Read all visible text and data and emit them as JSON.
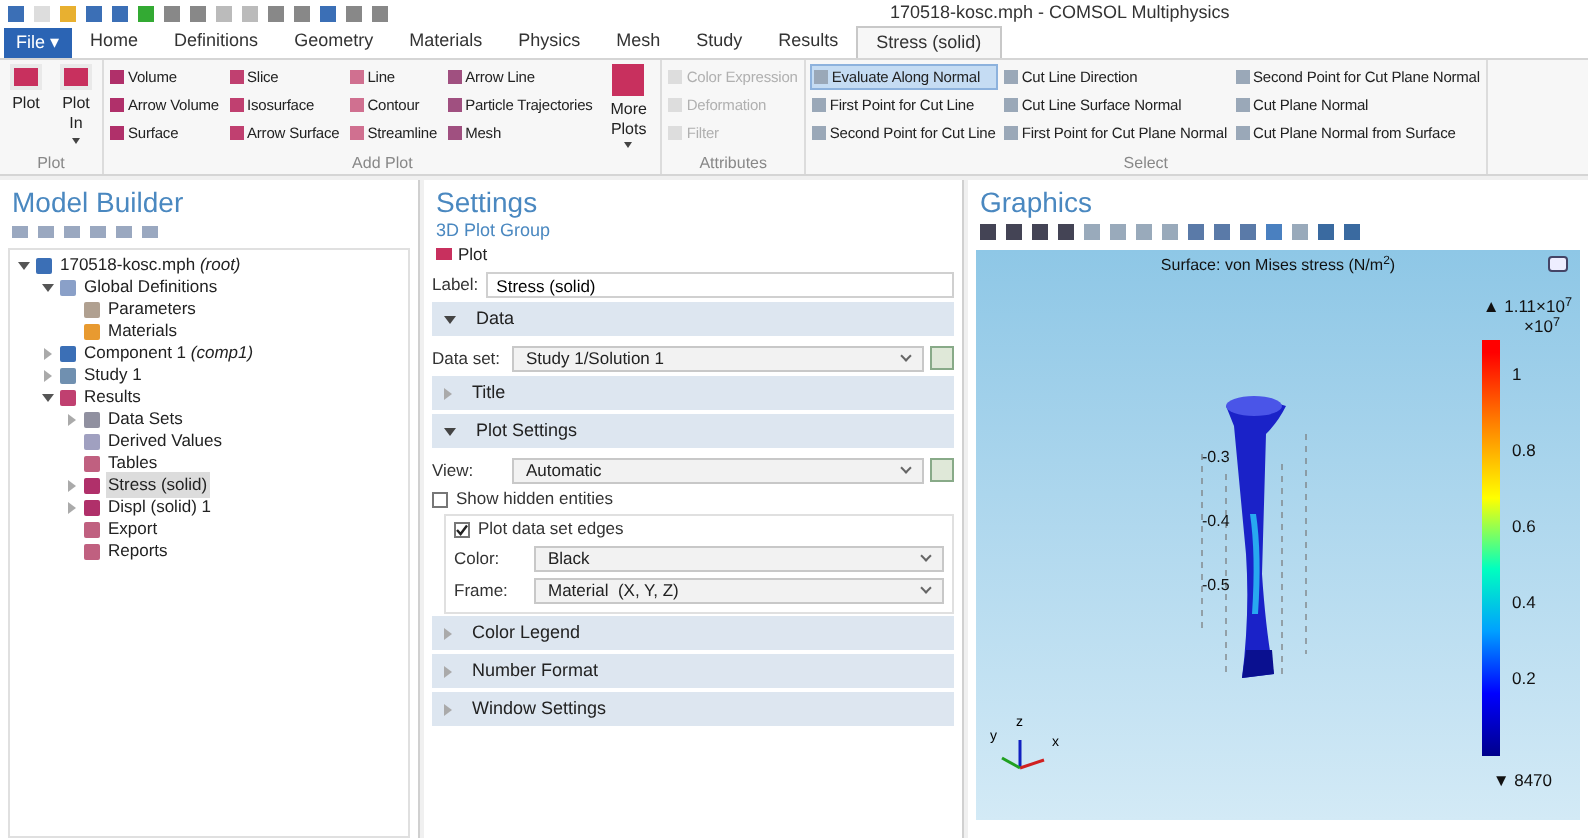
{
  "window": {
    "title": "170518-kosc.mph - COMSOL Multiphysics"
  },
  "tabs": [
    {
      "label": "File ▾",
      "kind": "file",
      "selected": false
    },
    {
      "label": "Home",
      "kind": "tab",
      "selected": false
    },
    {
      "label": "Definitions",
      "kind": "tab",
      "selected": false
    },
    {
      "label": "Geometry",
      "kind": "tab",
      "selected": false
    },
    {
      "label": "Materials",
      "kind": "tab",
      "selected": false
    },
    {
      "label": "Physics",
      "kind": "tab",
      "selected": false
    },
    {
      "label": "Mesh",
      "kind": "tab",
      "selected": false
    },
    {
      "label": "Study",
      "kind": "tab",
      "selected": false
    },
    {
      "label": "Results",
      "kind": "tab",
      "selected": false
    },
    {
      "label": "Stress (solid)",
      "kind": "tab",
      "selected": true
    }
  ],
  "ribbon": [
    {
      "title": "Plot",
      "kind": "large",
      "buttons": [
        {
          "label": "Plot",
          "caret": false
        },
        {
          "label": "Plot In",
          "caret": true
        }
      ]
    },
    {
      "title": "Add Plot",
      "kind": "columns",
      "columns": [
        [
          "Volume",
          "Arrow Volume",
          "Surface"
        ],
        [
          "Slice",
          "Isosurface",
          "Arrow Surface"
        ],
        [
          "Line",
          "Contour",
          "Streamline"
        ],
        [
          "Arrow Line",
          "Particle Trajectories",
          "Mesh"
        ]
      ],
      "more": {
        "label": "More Plots",
        "caret": true
      }
    },
    {
      "title": "Attributes",
      "kind": "list",
      "items": [
        {
          "label": "Color Expression",
          "disabled": true,
          "selected": false
        },
        {
          "label": "Deformation",
          "disabled": true,
          "selected": false
        },
        {
          "label": "Filter",
          "disabled": true,
          "selected": false
        }
      ]
    },
    {
      "title": "Select",
      "kind": "list",
      "items": [
        {
          "label": "Evaluate Along Normal",
          "disabled": false,
          "selected": true
        },
        {
          "label": "First Point for Cut Line",
          "disabled": false,
          "selected": false
        },
        {
          "label": "Second Point for Cut Line",
          "disabled": false,
          "selected": false
        },
        {
          "label": "Cut Line Direction",
          "disabled": false,
          "selected": false
        },
        {
          "label": "Cut Line Surface Normal",
          "disabled": false,
          "selected": false
        },
        {
          "label": "First Point for Cut Plane Normal",
          "disabled": false,
          "selected": false
        },
        {
          "label": "Second Point for Cut Plane Normal",
          "disabled": false,
          "selected": false
        },
        {
          "label": "Cut Plane Normal",
          "disabled": false,
          "selected": false
        },
        {
          "label": "Cut Plane Normal from Surface",
          "disabled": false,
          "selected": false
        }
      ]
    }
  ],
  "model_builder": {
    "title": "Model Builder",
    "tree": [
      {
        "name": "170518-kosc.mph",
        "suffix": "(root)",
        "expanded": true,
        "selected": false,
        "color": "#3b6fb6",
        "children": [
          {
            "name": "Global Definitions",
            "expanded": true,
            "selected": false,
            "color": "#8aa0c8",
            "children": [
              {
                "name": "Parameters",
                "selected": false,
                "color": "#b0a090"
              },
              {
                "name": "Materials",
                "selected": false,
                "color": "#e89a30"
              }
            ]
          },
          {
            "name": "Component 1",
            "suffix": "(comp1)",
            "expanded": false,
            "selected": false,
            "color": "#3b6fb6"
          },
          {
            "name": "Study 1",
            "expanded": false,
            "selected": false,
            "color": "#7090b0"
          },
          {
            "name": "Results",
            "expanded": true,
            "selected": false,
            "color": "#c04070",
            "children": [
              {
                "name": "Data Sets",
                "expanded": false,
                "selected": false,
                "color": "#9090a0"
              },
              {
                "name": "Derived Values",
                "selected": false,
                "color": "#a0a0c0"
              },
              {
                "name": "Tables",
                "selected": false,
                "color": "#c06080"
              },
              {
                "name": "Stress (solid)",
                "expanded": false,
                "selected": true,
                "color": "#b0306a"
              },
              {
                "name": "Displ (solid) 1",
                "expanded": false,
                "selected": false,
                "color": "#b0306a"
              },
              {
                "name": "Export",
                "selected": false,
                "color": "#c06080"
              },
              {
                "name": "Reports",
                "selected": false,
                "color": "#c06080"
              }
            ]
          }
        ]
      }
    ]
  },
  "settings": {
    "title": "Settings",
    "subtitle": "3D Plot Group",
    "action": "Plot",
    "label_field": {
      "label": "Label:",
      "value": "Stress (solid)"
    },
    "sections": [
      {
        "title": "Data",
        "expanded": true,
        "fields": [
          {
            "kind": "select",
            "label": "Data set:",
            "value": "Study 1/Solution 1",
            "reset": true
          }
        ]
      },
      {
        "title": "Title",
        "expanded": false
      },
      {
        "title": "Plot Settings",
        "expanded": true,
        "fields": [
          {
            "kind": "select",
            "label": "View:",
            "value": "Automatic",
            "reset": true
          },
          {
            "kind": "checkbox",
            "label": "Show hidden entities",
            "checked": false
          },
          {
            "kind": "group",
            "label": "Plot data set edges",
            "checked": true,
            "fields": [
              {
                "kind": "select",
                "label": "Color:",
                "value": "Black"
              },
              {
                "kind": "select",
                "label": "Frame:",
                "value": "Material  (X, Y, Z)"
              }
            ]
          }
        ]
      },
      {
        "title": "Color Legend",
        "expanded": false
      },
      {
        "title": "Number Format",
        "expanded": false
      },
      {
        "title": "Window Settings",
        "expanded": false
      }
    ]
  },
  "graphics": {
    "title": "Graphics",
    "plot_title": "Surface: von Mises stress (N/m$^{2}$)",
    "legend": {
      "max": "▲ 1.11×10$^{7}$",
      "factor": "×10$^{7}$",
      "ticks": [
        "1",
        "0.8",
        "0.6",
        "0.4",
        "0.2"
      ],
      "min": "▼ 8470"
    },
    "axis_labels": [
      "-0.3",
      "-0.4",
      "-0.5"
    ],
    "triad": [
      "x",
      "y",
      "z"
    ]
  }
}
